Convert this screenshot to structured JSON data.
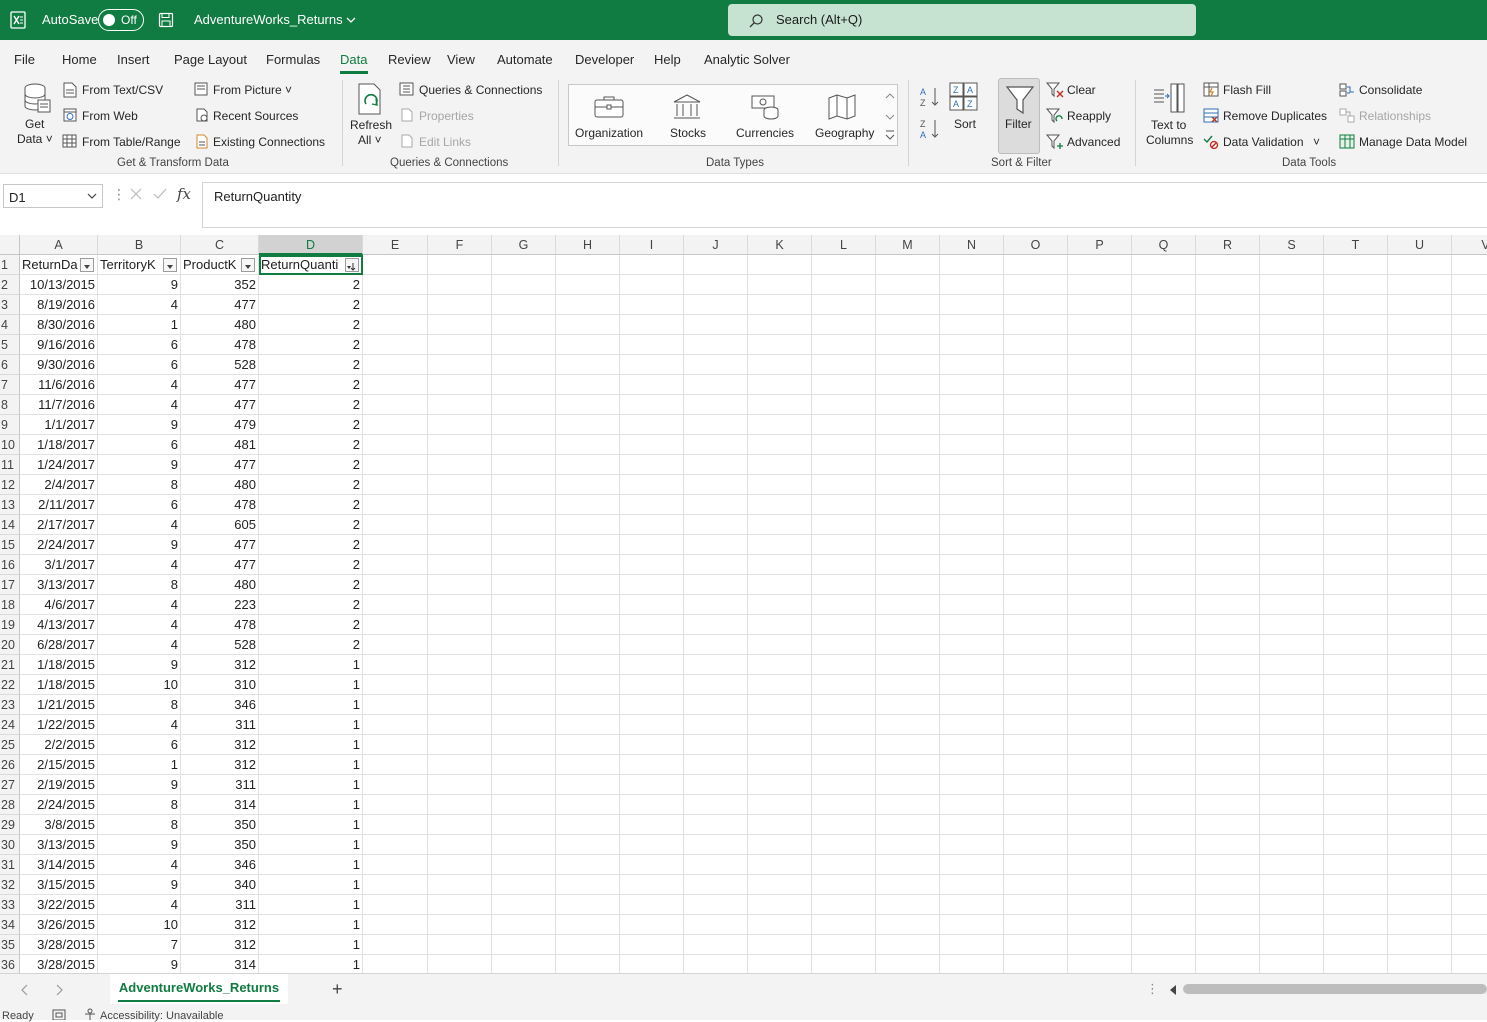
{
  "app": {
    "autosave_label": "AutoSave",
    "toggle_state": "Off",
    "filename": "AdventureWorks_Returns",
    "search_placeholder": "Search (Alt+Q)"
  },
  "menu": [
    "File",
    "Home",
    "Insert",
    "Page Layout",
    "Formulas",
    "Data",
    "Review",
    "View",
    "Automate",
    "Developer",
    "Help",
    "Analytic Solver"
  ],
  "ribbon": {
    "get_data": [
      "Get",
      "Data"
    ],
    "from_text_csv": "From Text/CSV",
    "from_web": "From Web",
    "from_table_range": "From Table/Range",
    "from_picture": "From Picture",
    "recent_sources": "Recent Sources",
    "existing_connections": "Existing Connections",
    "group_get_transform": "Get & Transform Data",
    "refresh_all": [
      "Refresh",
      "All"
    ],
    "queries_connections": "Queries & Connections",
    "properties": "Properties",
    "edit_links": "Edit Links",
    "group_queries": "Queries & Connections",
    "data_types": [
      "Organization",
      "Stocks",
      "Currencies",
      "Geography"
    ],
    "group_data_types": "Data Types",
    "sort": "Sort",
    "filter": "Filter",
    "clear": "Clear",
    "reapply": "Reapply",
    "advanced": "Advanced",
    "group_sort_filter": "Sort & Filter",
    "text_to_columns": [
      "Text to",
      "Columns"
    ],
    "flash_fill": "Flash Fill",
    "remove_duplicates": "Remove Duplicates",
    "data_validation": "Data Validation",
    "consolidate": "Consolidate",
    "relationships": "Relationships",
    "manage_data_model": "Manage Data Model",
    "group_data_tools": "Data Tools"
  },
  "formula_bar": {
    "name_box": "D1",
    "fx": "fx",
    "content": "ReturnQuantity"
  },
  "columns": [
    "A",
    "B",
    "C",
    "D",
    "E",
    "F",
    "G",
    "H",
    "I",
    "J",
    "K",
    "L",
    "M",
    "N",
    "O",
    "P",
    "Q",
    "R",
    "S",
    "T",
    "U",
    "V"
  ],
  "headers": [
    "ReturnDa",
    "TerritoryK",
    "ProductK",
    "ReturnQuanti"
  ],
  "rows": [
    [
      "10/13/2015",
      "9",
      "352",
      "2"
    ],
    [
      "8/19/2016",
      "4",
      "477",
      "2"
    ],
    [
      "8/30/2016",
      "1",
      "480",
      "2"
    ],
    [
      "9/16/2016",
      "6",
      "478",
      "2"
    ],
    [
      "9/30/2016",
      "6",
      "528",
      "2"
    ],
    [
      "11/6/2016",
      "4",
      "477",
      "2"
    ],
    [
      "11/7/2016",
      "4",
      "477",
      "2"
    ],
    [
      "1/1/2017",
      "9",
      "479",
      "2"
    ],
    [
      "1/18/2017",
      "6",
      "481",
      "2"
    ],
    [
      "1/24/2017",
      "9",
      "477",
      "2"
    ],
    [
      "2/4/2017",
      "8",
      "480",
      "2"
    ],
    [
      "2/11/2017",
      "6",
      "478",
      "2"
    ],
    [
      "2/17/2017",
      "4",
      "605",
      "2"
    ],
    [
      "2/24/2017",
      "9",
      "477",
      "2"
    ],
    [
      "3/1/2017",
      "4",
      "477",
      "2"
    ],
    [
      "3/13/2017",
      "8",
      "480",
      "2"
    ],
    [
      "4/6/2017",
      "4",
      "223",
      "2"
    ],
    [
      "4/13/2017",
      "4",
      "478",
      "2"
    ],
    [
      "6/28/2017",
      "4",
      "528",
      "2"
    ],
    [
      "1/18/2015",
      "9",
      "312",
      "1"
    ],
    [
      "1/18/2015",
      "10",
      "310",
      "1"
    ],
    [
      "1/21/2015",
      "8",
      "346",
      "1"
    ],
    [
      "1/22/2015",
      "4",
      "311",
      "1"
    ],
    [
      "2/2/2015",
      "6",
      "312",
      "1"
    ],
    [
      "2/15/2015",
      "1",
      "312",
      "1"
    ],
    [
      "2/19/2015",
      "9",
      "311",
      "1"
    ],
    [
      "2/24/2015",
      "8",
      "314",
      "1"
    ],
    [
      "3/8/2015",
      "8",
      "350",
      "1"
    ],
    [
      "3/13/2015",
      "9",
      "350",
      "1"
    ],
    [
      "3/14/2015",
      "4",
      "346",
      "1"
    ],
    [
      "3/15/2015",
      "9",
      "340",
      "1"
    ],
    [
      "3/22/2015",
      "4",
      "311",
      "1"
    ],
    [
      "3/26/2015",
      "10",
      "312",
      "1"
    ],
    [
      "3/28/2015",
      "7",
      "312",
      "1"
    ],
    [
      "3/28/2015",
      "9",
      "314",
      "1"
    ]
  ],
  "sheet": {
    "tab_name": "AdventureWorks_Returns",
    "add_sheet": "+"
  },
  "status": {
    "ready": "Ready",
    "accessibility": "Accessibility: Unavailable"
  }
}
